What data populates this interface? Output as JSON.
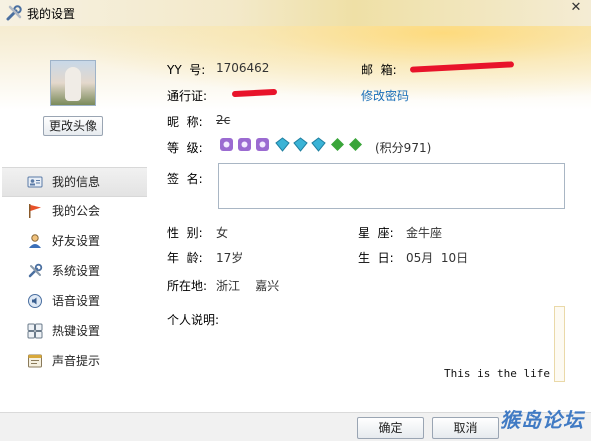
{
  "window": {
    "title": "我的设置",
    "close_glyph": "✕"
  },
  "profile": {
    "change_avatar_label": "更改头像"
  },
  "nav": {
    "items": [
      {
        "label": "我的信息",
        "icon": "id-card-icon",
        "active": true
      },
      {
        "label": "我的公会",
        "icon": "flag-icon",
        "active": false
      },
      {
        "label": "好友设置",
        "icon": "person-icon",
        "active": false
      },
      {
        "label": "系统设置",
        "icon": "tools-icon",
        "active": false
      },
      {
        "label": "语音设置",
        "icon": "speaker-icon",
        "active": false
      },
      {
        "label": "热键设置",
        "icon": "keyboard-icon",
        "active": false
      },
      {
        "label": "声音提示",
        "icon": "sound-alert-icon",
        "active": false
      }
    ]
  },
  "info": {
    "yy_label": "YY  号:",
    "yy_value": "1706462",
    "email_label": "邮  箱:",
    "pass_label": "通行证:",
    "change_password": "修改密码",
    "nickname_label": "昵  称:",
    "nickname_value": "2c",
    "level_label": "等  级:",
    "level_points": "(积分971)",
    "signature_label": "签  名:",
    "gender_label": "性  别:",
    "gender_value": "女",
    "zodiac_label": "星  座:",
    "zodiac_value": "金牛座",
    "age_label": "年  龄:",
    "age_value": "17岁",
    "birthday_label": "生  日:",
    "birthday_value": "05月  10日",
    "location_label": "所在地:",
    "location_value": "浙江    嘉兴",
    "description_label": "个人说明:",
    "description_value": "This is the life"
  },
  "buttons": {
    "ok": "确定",
    "cancel": "取消"
  },
  "watermark": {
    "text": "猴岛论坛"
  },
  "colors": {
    "link": "#1a6fb8",
    "redaction": "#e8132a",
    "badge_purple": "#9b6bd1",
    "badge_cyan": "#3ab3d6",
    "badge_green": "#3aa53a"
  }
}
